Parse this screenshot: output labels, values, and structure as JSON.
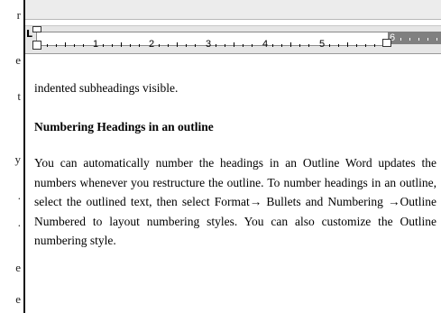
{
  "left_margin_fragments": [
    "r",
    "e",
    "t",
    "y",
    ".",
    ".",
    "e",
    "e"
  ],
  "ruler": {
    "tab_selector": "L",
    "numbers": [
      "1",
      "2",
      "3",
      "4",
      "5",
      "6"
    ]
  },
  "document": {
    "fragment_line": "indented subheadings visible.",
    "heading": "Numbering Headings in an outline",
    "paragraph": "You can automatically number the headings in an Outline Word updates the numbers whenever you restructure the outline.  To number headings in an outline, select the outlined text, then select Format→ Bullets and Numbering →Outline Numbered to layout numbering styles. You can also customize the Outline numbering style."
  }
}
